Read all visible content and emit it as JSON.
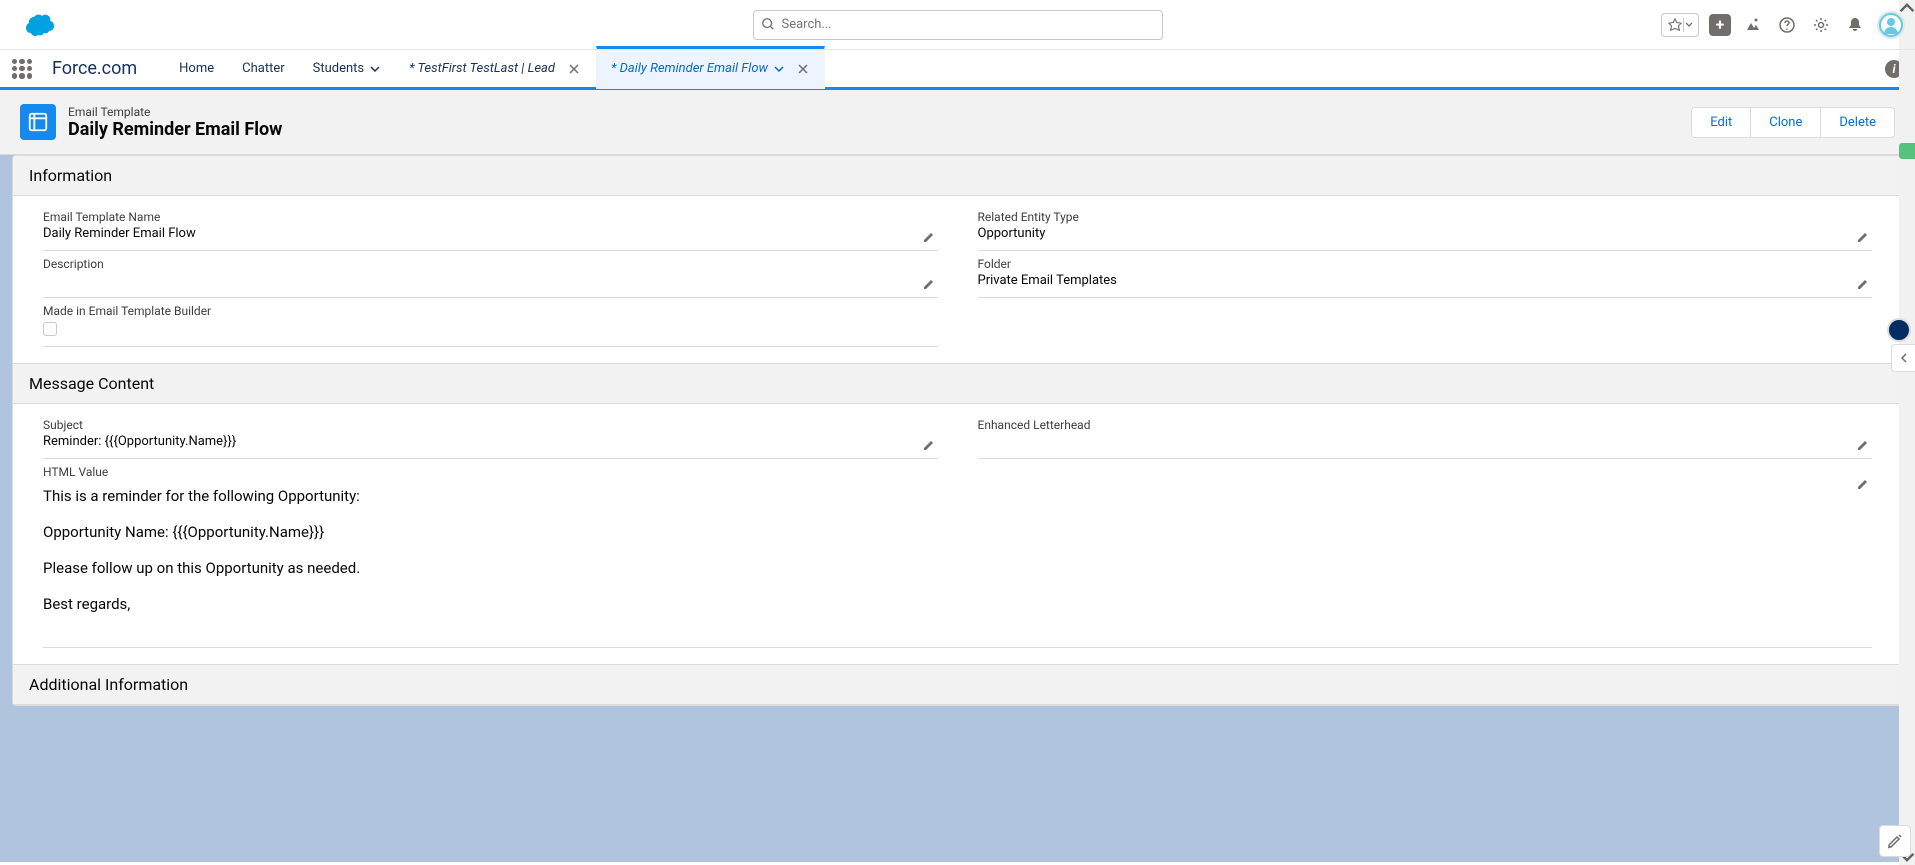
{
  "search": {
    "placeholder": "Search..."
  },
  "nav": {
    "app_name": "Force.com",
    "items": [
      "Home",
      "Chatter",
      "Students"
    ],
    "tabs": [
      {
        "label": "* TestFirst TestLast | Lead",
        "active": false
      },
      {
        "label": "* Daily Reminder Email Flow",
        "active": true
      }
    ]
  },
  "record": {
    "type": "Email Template",
    "name": "Daily Reminder Email Flow",
    "actions": {
      "edit": "Edit",
      "clone": "Clone",
      "delete": "Delete"
    }
  },
  "sections": {
    "information": {
      "title": "Information",
      "template_name": {
        "label": "Email Template Name",
        "value": "Daily Reminder Email Flow"
      },
      "related_entity": {
        "label": "Related Entity Type",
        "value": "Opportunity"
      },
      "description": {
        "label": "Description",
        "value": ""
      },
      "folder": {
        "label": "Folder",
        "value": "Private Email Templates"
      },
      "made_in_builder": {
        "label": "Made in Email Template Builder"
      }
    },
    "message_content": {
      "title": "Message Content",
      "subject": {
        "label": "Subject",
        "value": "Reminder: {{{Opportunity.Name}}}"
      },
      "enhanced_letterhead": {
        "label": "Enhanced Letterhead",
        "value": ""
      },
      "html_value": {
        "label": "HTML Value",
        "lines": [
          "This is a reminder for the following Opportunity:",
          "Opportunity Name: {{{Opportunity.Name}}}",
          "Please follow up on this Opportunity as needed.",
          "Best regards,"
        ]
      }
    },
    "additional": {
      "title": "Additional Information"
    }
  }
}
